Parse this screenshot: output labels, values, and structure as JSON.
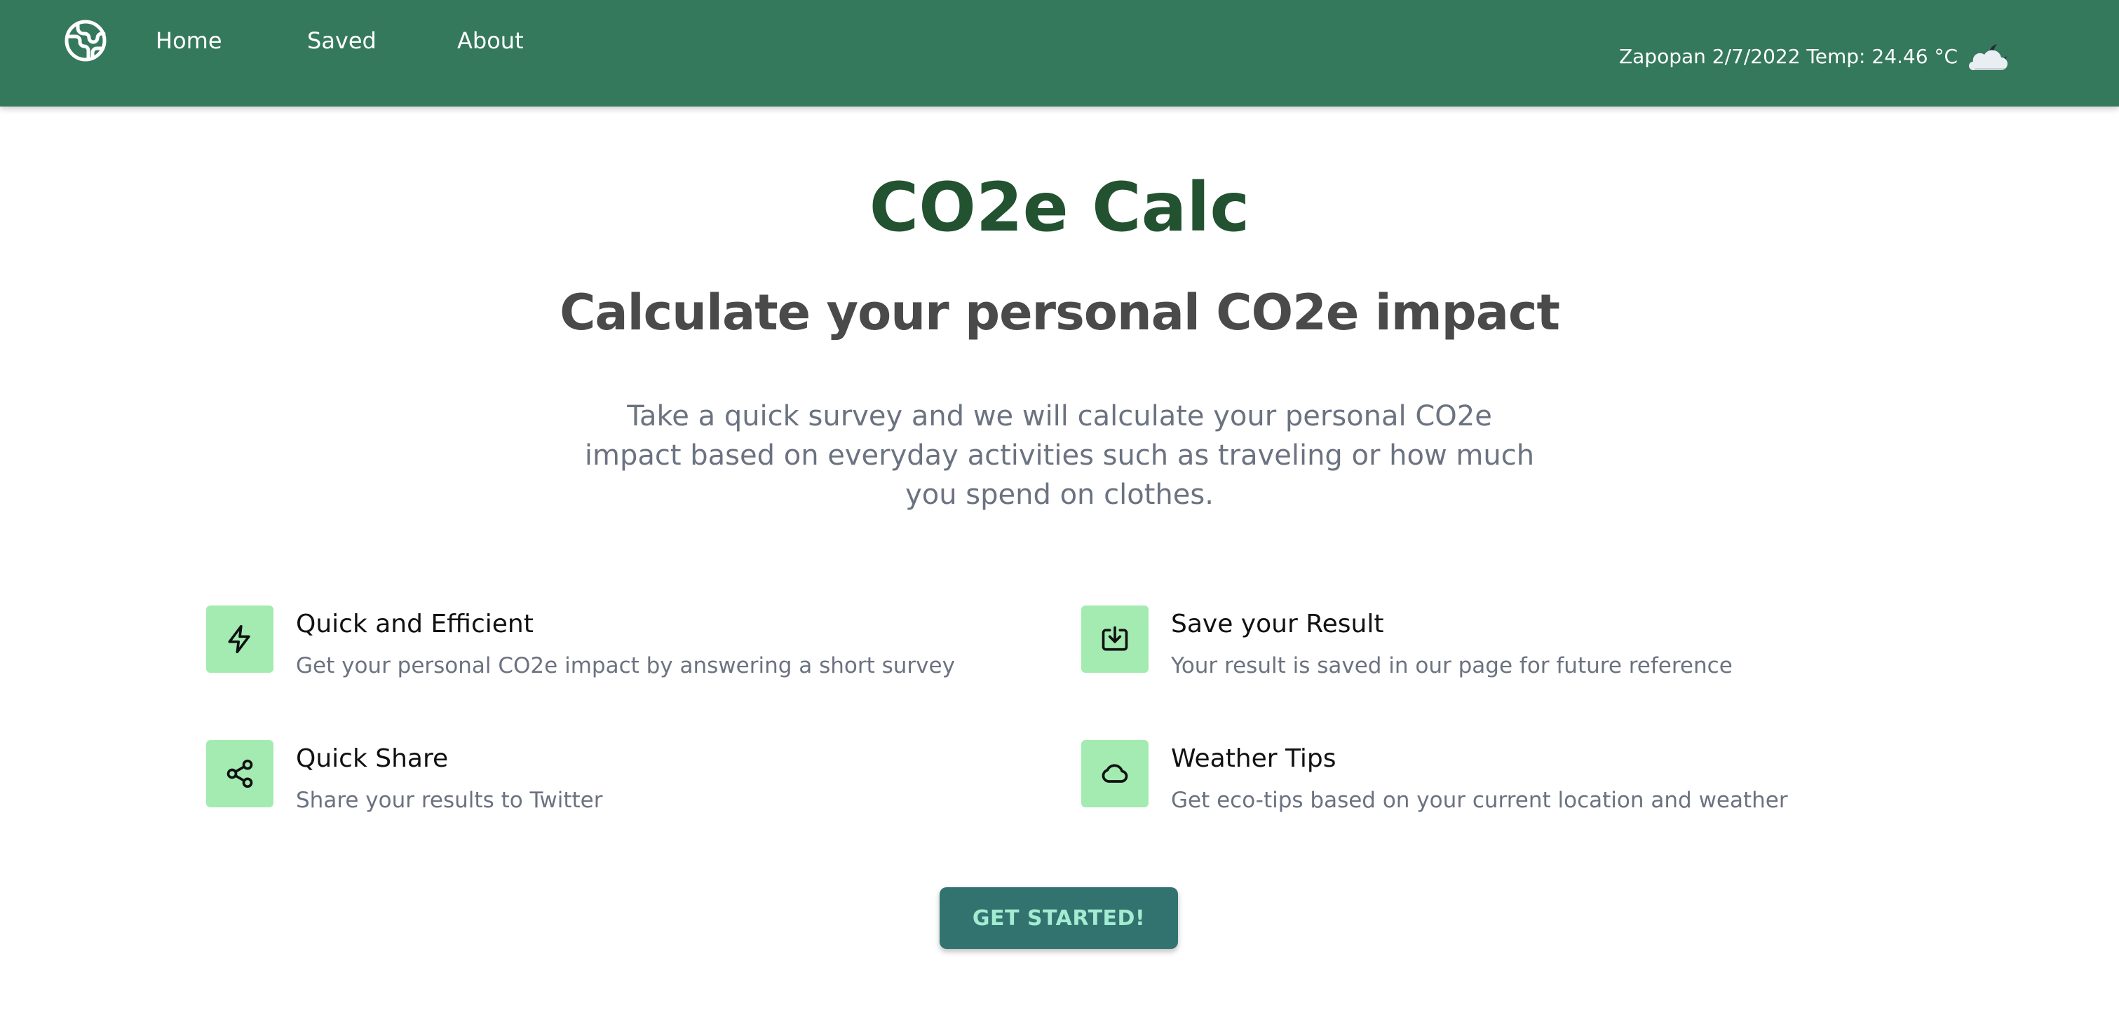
{
  "nav": {
    "logo_icon": "globe-icon",
    "links": [
      {
        "label": "Home"
      },
      {
        "label": "Saved"
      },
      {
        "label": "About"
      }
    ],
    "weather": {
      "text": "Zapopan 2/7/2022 Temp: 24.46 °C",
      "icon": "partly-cloudy-night-icon"
    }
  },
  "hero": {
    "title": "CO2e Calc",
    "subtitle": "Calculate your personal CO2e impact",
    "intro": "Take a quick survey and we will calculate your personal CO2e impact based on everyday activities such as traveling or how much you spend on clothes."
  },
  "features": [
    {
      "icon": "lightning-icon",
      "title": "Quick and Efficient",
      "description": "Get your personal CO2e impact by answering a short survey"
    },
    {
      "icon": "download-icon",
      "title": "Save your Result",
      "description": "Your result is saved in our page for future reference"
    },
    {
      "icon": "share-icon",
      "title": "Quick Share",
      "description": "Share your results to Twitter"
    },
    {
      "icon": "cloud-icon",
      "title": "Weather Tips",
      "description": "Get eco-tips based on your current location and weather"
    }
  ],
  "cta": {
    "label": "GET STARTED!"
  },
  "colors": {
    "navbar_bg": "#35795c",
    "title": "#22522f",
    "subtitle": "#4a4a4a",
    "muted_text": "#6b7280",
    "feature_icon_bg": "#a3ebb1",
    "cta_bg": "#327370",
    "cta_text": "#a3ebd1"
  }
}
